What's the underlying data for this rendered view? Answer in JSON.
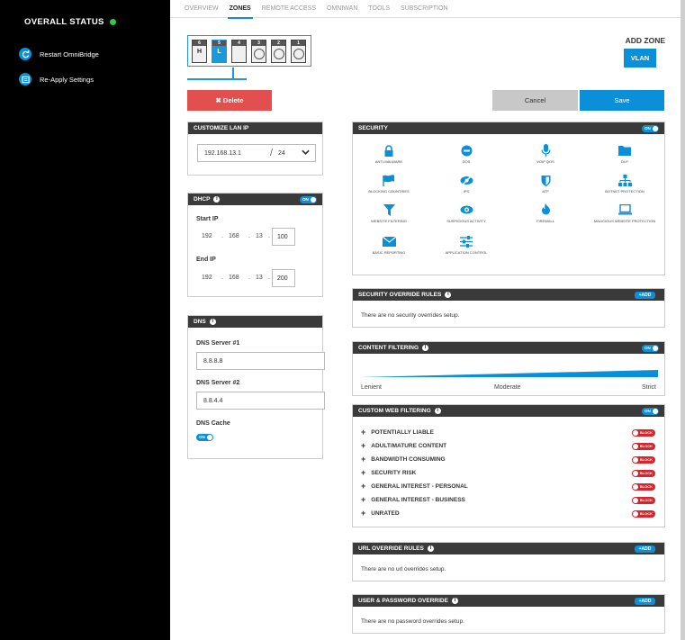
{
  "sidebar": {
    "title": "OVERALL STATUS",
    "items": [
      {
        "label": "Restart OmniBridge",
        "icon": "refresh-icon"
      },
      {
        "label": "Re-Apply Settings",
        "icon": "settings-list-icon"
      }
    ]
  },
  "tabs": [
    {
      "label": "OVERVIEW",
      "active": false
    },
    {
      "label": "ZONES",
      "active": true
    },
    {
      "label": "REMOTE ACCESS",
      "active": false
    },
    {
      "label": "OMNIWAN",
      "active": false
    },
    {
      "label": "TOOLS",
      "active": false
    },
    {
      "label": "SUBSCRIPTION",
      "active": false
    }
  ],
  "ports": [
    {
      "num": "6",
      "label": "H",
      "selected": false
    },
    {
      "num": "5",
      "label": "L",
      "selected": true
    },
    {
      "num": "4",
      "label": "",
      "selected": false
    },
    {
      "num": "3",
      "label": "",
      "selected": false
    },
    {
      "num": "2",
      "label": "",
      "selected": false
    },
    {
      "num": "1",
      "label": "",
      "selected": false
    }
  ],
  "add_zone": {
    "title": "ADD ZONE",
    "vlan_label": "VLAN"
  },
  "actions": {
    "delete_label": "✖ Delete",
    "cancel_label": "Cancel",
    "save_label": "Save"
  },
  "lan": {
    "title": "CUSTOMIZE LAN IP",
    "ip": "192.168.13.1",
    "sep": "/",
    "mask": "24"
  },
  "dhcp": {
    "title": "DHCP",
    "toggle": "ON",
    "start_label": "Start IP",
    "end_label": "End IP",
    "start": [
      "192",
      "168",
      "13",
      "100"
    ],
    "end": [
      "192",
      "168",
      "13",
      "200"
    ],
    "dot": "."
  },
  "dns": {
    "title": "DNS",
    "server1_label": "DNS Server #1",
    "server1": "8.8.8.8",
    "server2_label": "DNS Server #2",
    "server2": "8.8.4.4",
    "cache_label": "DNS Cache",
    "cache_toggle": "ON"
  },
  "security": {
    "title": "SECURITY",
    "toggle": "ON",
    "items": [
      {
        "label": "ANTI-MALWARE",
        "icon": "lock-icon"
      },
      {
        "label": "DOS",
        "icon": "no-entry-icon"
      },
      {
        "label": "VOIP QOS",
        "icon": "microphone-icon"
      },
      {
        "label": "DLP",
        "icon": "folder-icon"
      },
      {
        "label": "BLOCKING COUNTRIES",
        "icon": "flag-icon"
      },
      {
        "label": "IPS",
        "icon": "eye-slash-icon"
      },
      {
        "label": "ATP",
        "icon": "shield-icon"
      },
      {
        "label": "BOTNET PROTECTION",
        "icon": "sitemap-icon"
      },
      {
        "label": "WEBSITE FILTERING",
        "icon": "filter-icon"
      },
      {
        "label": "SUSPICIOUS ACTIVITY",
        "icon": "eye-icon"
      },
      {
        "label": "FIREWALL",
        "icon": "fire-icon"
      },
      {
        "label": "MALICIOUS WEBSITE PROTECTION",
        "icon": "laptop-icon"
      },
      {
        "label": "BASIC REPORTING",
        "icon": "envelope-icon"
      },
      {
        "label": "APPLICATION CONTROL",
        "icon": "sliders-icon"
      }
    ]
  },
  "security_override": {
    "title": "SECURITY OVERRIDE RULES",
    "add": "+ADD",
    "empty": "There are no security overrides setup."
  },
  "content_filtering": {
    "title": "CONTENT FILTERING",
    "toggle": "ON",
    "labels": [
      "Lenient",
      "Moderate",
      "Strict"
    ],
    "level": 1.0
  },
  "cwf": {
    "title": "CUSTOM WEB FILTERING",
    "toggle": "ON",
    "block_label": "BLOCK",
    "rows": [
      "POTENTIALLY LIABLE",
      "ADULT/MATURE CONTENT",
      "BANDWIDTH CONSUMING",
      "SECURITY RISK",
      "GENERAL INTEREST - PERSONAL",
      "GENERAL INTEREST - BUSINESS",
      "UNRATED"
    ]
  },
  "url_override": {
    "title": "URL OVERRIDE RULES",
    "add": "+ADD",
    "empty": "There are no url overrides setup."
  },
  "user_override": {
    "title": "USER & PASSWORD OVERRIDE",
    "add": "+ADD",
    "empty": "There are no password overrides setup."
  },
  "colors": {
    "accent": "#0a8fd8",
    "danger": "#e14f4f",
    "header": "#3a3a3a",
    "status_ok": "#2ecc40"
  }
}
